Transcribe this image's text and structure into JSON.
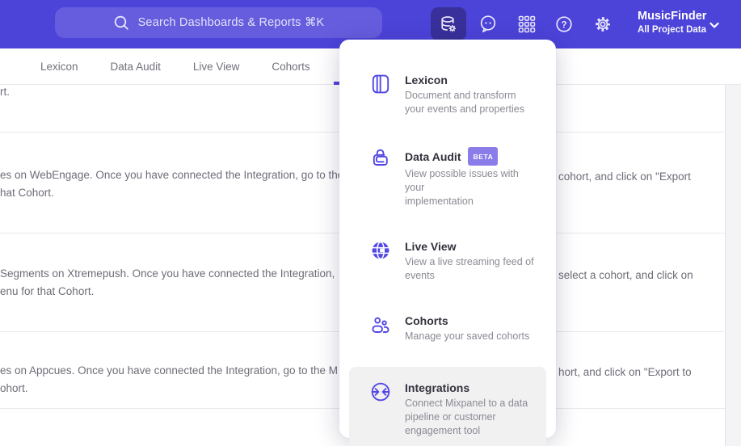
{
  "header": {
    "search": {
      "placeholder": "Search Dashboards & Reports ⌘K"
    },
    "project": {
      "name": "MusicFinder",
      "subtitle": "All Project Data"
    }
  },
  "tabs": [
    {
      "label": "Lexicon"
    },
    {
      "label": "Data Audit"
    },
    {
      "label": "Live View"
    },
    {
      "label": "Cohorts"
    }
  ],
  "menu": {
    "items": [
      {
        "title": "Lexicon",
        "desc": "Document and transform\nyour events and properties"
      },
      {
        "title": "Data Audit",
        "badge": "BETA",
        "desc": "View possible issues with your\nimplementation"
      },
      {
        "title": "Live View",
        "desc": "View a live streaming feed of\nevents"
      },
      {
        "title": "Cohorts",
        "desc": "Manage your saved cohorts"
      },
      {
        "title": "Integrations",
        "desc": "Connect Mixpanel to a data\npipeline or customer\nengagement tool"
      }
    ]
  },
  "content": {
    "rows": [
      {
        "left1": "rt."
      },
      {
        "left1": "es on WebEngage. Once you have connected the Integration, go to the",
        "right1": "cohort, and click on \"Export",
        "left2": "hat Cohort."
      },
      {
        "left1": "Segments on Xtremepush. Once you have connected the Integration,",
        "right1": "select a cohort, and click on",
        "left2": "enu for that Cohort."
      },
      {
        "left1": "es on Appcues. Once you have connected the Integration, go to the M",
        "right1": "hort, and click on \"Export to",
        "left2": "ohort."
      }
    ]
  },
  "colors": {
    "header_bg": "#4c43d9",
    "accent": "#5247e5",
    "active_button_bg": "#39309b",
    "badge_bg": "#8b7de9",
    "hover_bg": "#f1f1f2",
    "tab_indicator": "#4f44e0"
  }
}
